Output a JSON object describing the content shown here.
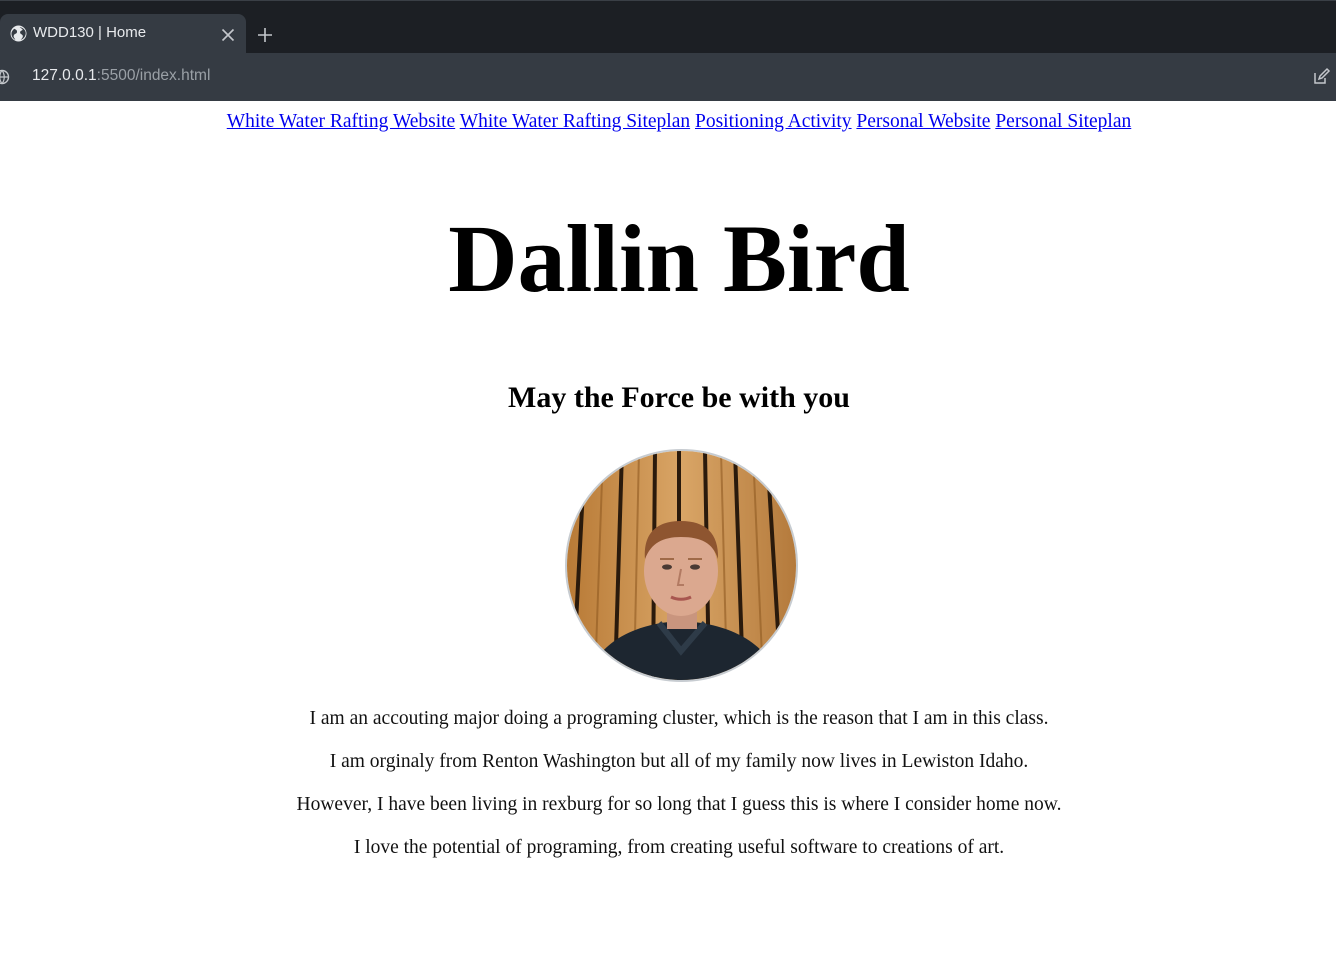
{
  "browser": {
    "tab": {
      "title": "WDD130 | Home",
      "icon": "globe-icon",
      "close_icon": "close-icon"
    },
    "new_tab_icon": "plus-icon",
    "address": {
      "host": "127.0.0.1",
      "rest": ":5500/index.html",
      "site_icon": "site-info-icon"
    },
    "edit_icon": "edit-icon",
    "colors": {
      "tabbar": "#1c1f24",
      "toolbar": "#353b43"
    }
  },
  "nav": {
    "links": [
      {
        "label": "White Water Rafting Website"
      },
      {
        "label": "White Water Rafting Siteplan"
      },
      {
        "label": "Positioning Activity"
      },
      {
        "label": "Personal Website"
      },
      {
        "label": "Personal Siteplan"
      }
    ],
    "link_color": "#0000ee"
  },
  "header": {
    "name": "Dallin Bird",
    "motto": "May the Force be with you"
  },
  "profile": {
    "photo": "profile-photo"
  },
  "bio": {
    "lines": [
      "I am an accouting major doing a programing cluster, which is the reason that I am in this class.",
      "I am orginaly from Renton Washington but all of my family now lives in Lewiston Idaho.",
      "However, I have been living in rexburg for so long that I guess this is where I consider home now.",
      "I love the potential of programing, from creating useful software to creations of art."
    ]
  }
}
